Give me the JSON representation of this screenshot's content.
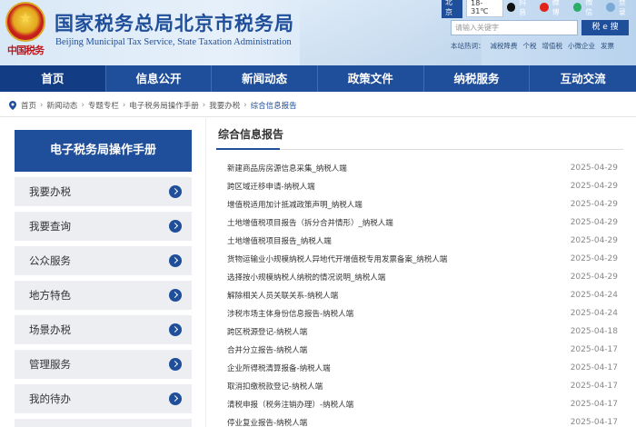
{
  "header": {
    "emblem_text": "中国税务",
    "title": "国家税务总局北京市税务局",
    "subtitle": "Beijing Municipal Tax Service, State Taxation Administration"
  },
  "topbar": {
    "city": "北京",
    "weather": "18-31℃",
    "links": [
      {
        "icon": "tiktok-icon",
        "label": "抖音"
      },
      {
        "icon": "weibo-icon",
        "label": "微博"
      },
      {
        "icon": "wechat-icon",
        "label": "微信"
      },
      {
        "icon": "user-icon",
        "label": "登录"
      }
    ]
  },
  "search": {
    "placeholder": "请输入关键字",
    "button": "税 e 搜",
    "hot_label": "本站热词：",
    "hot_words": [
      "减税降费",
      "个税",
      "增值税",
      "小微企业",
      "发票"
    ]
  },
  "nav": {
    "items": [
      {
        "label": "首页",
        "active": true
      },
      {
        "label": "信息公开",
        "active": false
      },
      {
        "label": "新闻动态",
        "active": false
      },
      {
        "label": "政策文件",
        "active": false
      },
      {
        "label": "纳税服务",
        "active": false
      },
      {
        "label": "互动交流",
        "active": false
      }
    ]
  },
  "breadcrumb": [
    "首页",
    "新闻动态",
    "专题专栏",
    "电子税务局操作手册",
    "我要办税",
    "综合信息报告"
  ],
  "sidebar": {
    "title": "电子税务局操作手册",
    "items": [
      "我要办税",
      "我要查询",
      "公众服务",
      "地方特色",
      "场景办税",
      "管理服务",
      "我的待办",
      "其它"
    ]
  },
  "main": {
    "title": "综合信息报告",
    "items": [
      {
        "title": "新建商品房房源信息采集_纳税人端",
        "date": "2025-04-29"
      },
      {
        "title": "跨区域迁移申请-纳税人端",
        "date": "2025-04-29"
      },
      {
        "title": "增值税适用加计抵减政策声明_纳税人端",
        "date": "2025-04-29"
      },
      {
        "title": "土地增值税项目报告（拆分合并情形）_纳税人端",
        "date": "2025-04-29"
      },
      {
        "title": "土地增值税项目报告_纳税人端",
        "date": "2025-04-29"
      },
      {
        "title": "货物运输业小规模纳税人异地代开增值税专用发票备案_纳税人端",
        "date": "2025-04-29"
      },
      {
        "title": "选择按小规模纳税人纳税的情况说明_纳税人端",
        "date": "2025-04-29"
      },
      {
        "title": "解除相关人员关联关系-纳税人端",
        "date": "2025-04-24"
      },
      {
        "title": "涉税市场主体身份信息报告-纳税人端",
        "date": "2025-04-24"
      },
      {
        "title": "跨区税源登记-纳税人端",
        "date": "2025-04-18"
      },
      {
        "title": "合并分立报告-纳税人端",
        "date": "2025-04-17"
      },
      {
        "title": "企业所得税清算报备-纳税人端",
        "date": "2025-04-17"
      },
      {
        "title": "取消扣缴税款登记-纳税人端",
        "date": "2025-04-17"
      },
      {
        "title": "清税申报（税务注销办理）-纳税人端",
        "date": "2025-04-17"
      },
      {
        "title": "停业复业报告-纳税人端",
        "date": "2025-04-17"
      }
    ]
  }
}
